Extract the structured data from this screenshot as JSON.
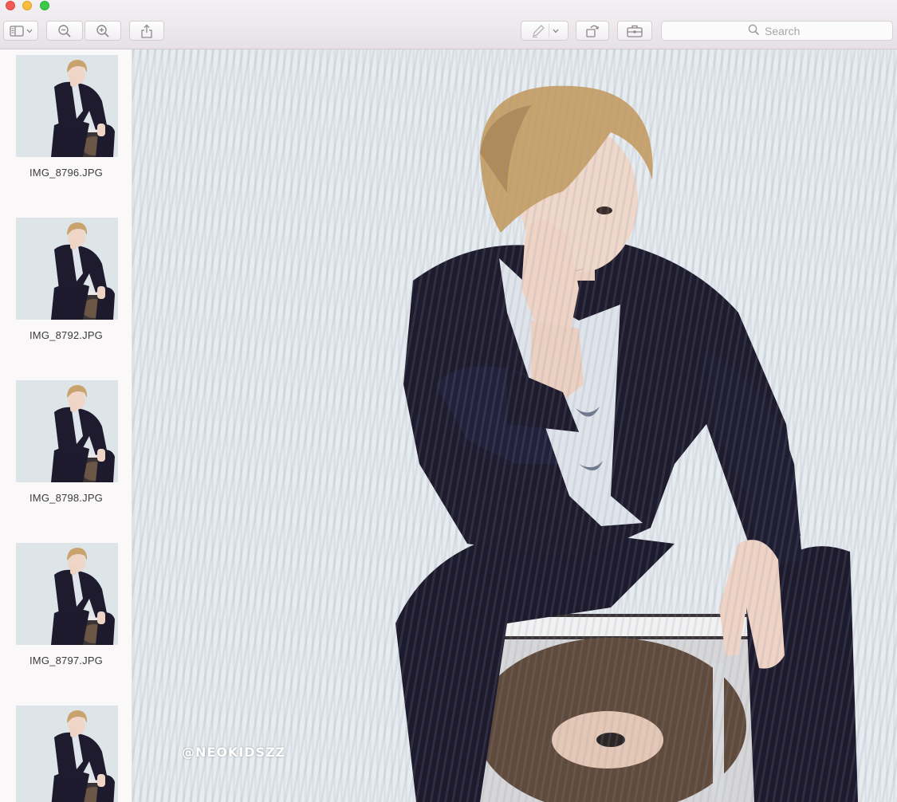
{
  "window": {
    "controls": [
      "close",
      "minimize",
      "zoom"
    ]
  },
  "toolbar": {
    "sidebar_toggle_icon": "sidebar-icon",
    "zoom_out_icon": "zoom-out-icon",
    "zoom_in_icon": "zoom-in-icon",
    "share_icon": "share-icon",
    "markup_icon": "pen-icon",
    "rotate_icon": "rotate-icon",
    "toolbox_icon": "toolbox-icon",
    "search": {
      "placeholder": "Search",
      "value": ""
    }
  },
  "sidebar": {
    "items": [
      {
        "label": "IMG_8796.JPG"
      },
      {
        "label": "IMG_8792.JPG"
      },
      {
        "label": "IMG_8798.JPG"
      },
      {
        "label": "IMG_8797.JPG"
      },
      {
        "label": ""
      }
    ]
  },
  "viewer": {
    "watermark": "@NEOKIDSZZ"
  },
  "colors": {
    "close": "#f25b55",
    "minimize": "#f7bd3b",
    "zoom": "#3dc94a",
    "backdrop": "#e7ecf0",
    "suit": "#1c1a2c",
    "hair": "#c9a36d"
  }
}
